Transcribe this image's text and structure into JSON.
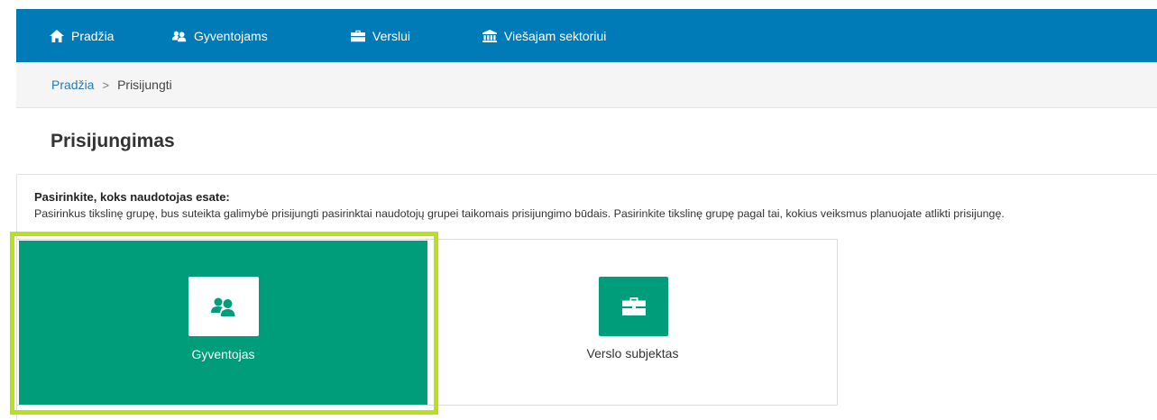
{
  "nav": {
    "items": [
      {
        "label": "Pradžia",
        "icon": "home-icon"
      },
      {
        "label": "Gyventojams",
        "icon": "people-icon"
      },
      {
        "label": "Verslui",
        "icon": "briefcase-icon"
      },
      {
        "label": "Viešajam sektoriui",
        "icon": "institution-icon"
      }
    ],
    "background": "#007bb8"
  },
  "breadcrumb": {
    "home": "Pradžia",
    "separator": ">",
    "current": "Prisijungti"
  },
  "page": {
    "title": "Prisijungimas"
  },
  "instructions": {
    "heading": "Pasirinkite, koks naudotojas esate:",
    "text": "Pasirinkus tikslinę grupę, bus suteikta galimybė prisijungti pasirinktai naudotojų grupei taikomais prisijungimo būdais. Pasirinkite tikslinę grupę pagal tai, kokius veiksmus planuojate atlikti prisijungę."
  },
  "options": [
    {
      "label": "Gyventojas",
      "icon": "people-icon",
      "selected": true
    },
    {
      "label": "Verslo subjektas",
      "icon": "briefcase-icon",
      "selected": false
    }
  ],
  "colors": {
    "accent_green": "#009d7b",
    "highlight": "#b5e21c",
    "link": "#2a7ab0"
  }
}
